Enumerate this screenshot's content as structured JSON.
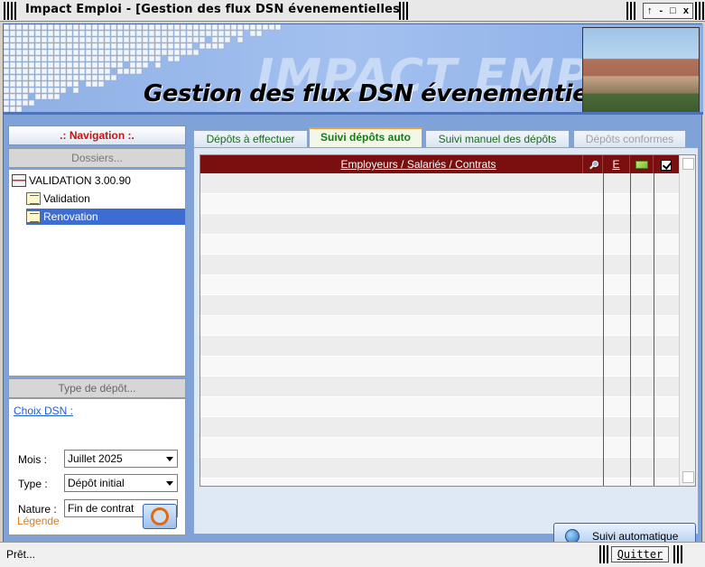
{
  "window": {
    "title": "Impact Emploi - [Gestion des flux DSN évenementielles]",
    "controls": [
      "↑",
      "-",
      "□",
      "x"
    ]
  },
  "banner": {
    "brand": "IMPACT EMPLOI",
    "title": "Gestion des flux DSN évenementielles"
  },
  "navigation": {
    "header": ".: Navigation :.",
    "dossiers_label": "Dossiers...",
    "tree": [
      {
        "label": "VALIDATION 3.00.90",
        "level": 0,
        "icon": "database-icon",
        "selected": false
      },
      {
        "label": "Validation",
        "level": 1,
        "icon": "document-edit-icon",
        "selected": false
      },
      {
        "label": "Renovation",
        "level": 1,
        "icon": "document-edit-icon",
        "selected": true
      }
    ],
    "type_depot_label": "Type de dépôt...",
    "choix_dsn_label": "Choix DSN :",
    "fields": {
      "mois": {
        "label": "Mois :",
        "value": "Juillet 2025"
      },
      "type": {
        "label": "Type :",
        "value": "Dépôt initial"
      },
      "nature": {
        "label": "Nature :",
        "value": "Fin de contrat"
      }
    },
    "legende_label": "Légende"
  },
  "tabs": [
    {
      "label": "Dépôts à effectuer",
      "active": false,
      "disabled": false
    },
    {
      "label": "Suivi dépôts auto",
      "active": true,
      "disabled": false
    },
    {
      "label": "Suivi manuel des dépôts",
      "active": false,
      "disabled": false
    },
    {
      "label": "Dépôts conformes",
      "active": false,
      "disabled": true
    }
  ],
  "grid": {
    "columns": {
      "main": "Employeurs / Salariés / Contrats",
      "e": "E"
    },
    "icons": [
      "magnifier-icon",
      "flag-icon",
      "checkbox-icon"
    ],
    "header_color": "#7b0e0e"
  },
  "actions": {
    "suivi_automatique": "Suivi automatique"
  },
  "statusbar": {
    "status": "Prêt...",
    "quit": "Quitter"
  }
}
